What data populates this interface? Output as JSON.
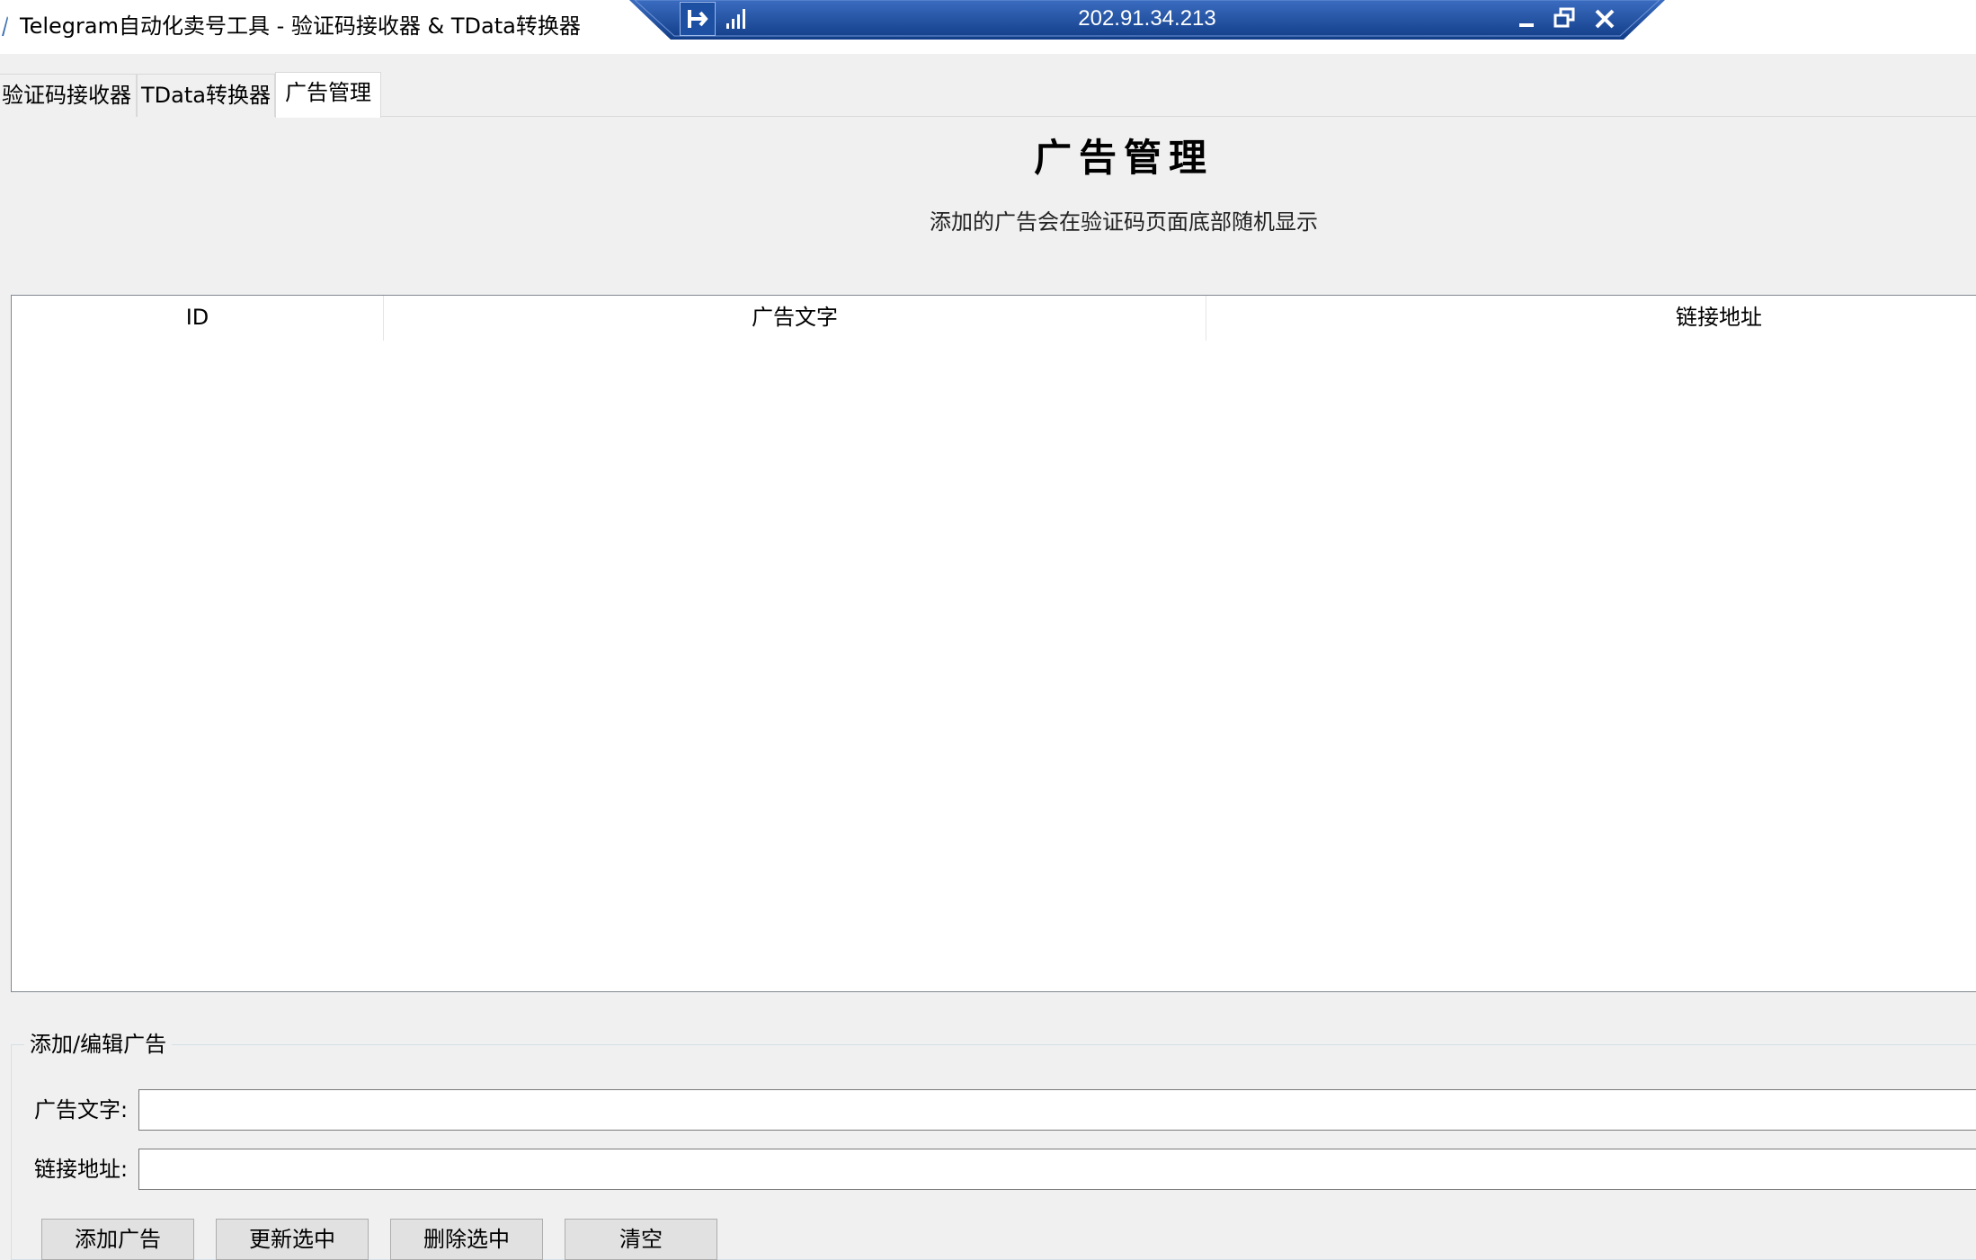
{
  "window": {
    "title": "Telegram自动化卖号工具 - 验证码接收器 & TData转换器"
  },
  "rdp": {
    "host": "202.91.34.213"
  },
  "tabs": [
    {
      "label": "验证码接收器",
      "active": false
    },
    {
      "label": "TData转换器",
      "active": false
    },
    {
      "label": "广告管理",
      "active": true
    }
  ],
  "header": {
    "title": "广告管理",
    "subtitle": "添加的广告会在验证码页面底部随机显示"
  },
  "table": {
    "columns": [
      "ID",
      "广告文字",
      "链接地址"
    ],
    "rows": []
  },
  "form": {
    "group_label": "添加/编辑广告",
    "ad_text_label": "广告文字:",
    "ad_text_value": "",
    "link_label": "链接地址:",
    "link_value": ""
  },
  "buttons": {
    "add": "添加广告",
    "update": "更新选中",
    "delete": "删除选中",
    "clear": "清空"
  },
  "colors": {
    "rdp_bar": "#1e4c9a",
    "window_bg": "#f0f0f0"
  }
}
